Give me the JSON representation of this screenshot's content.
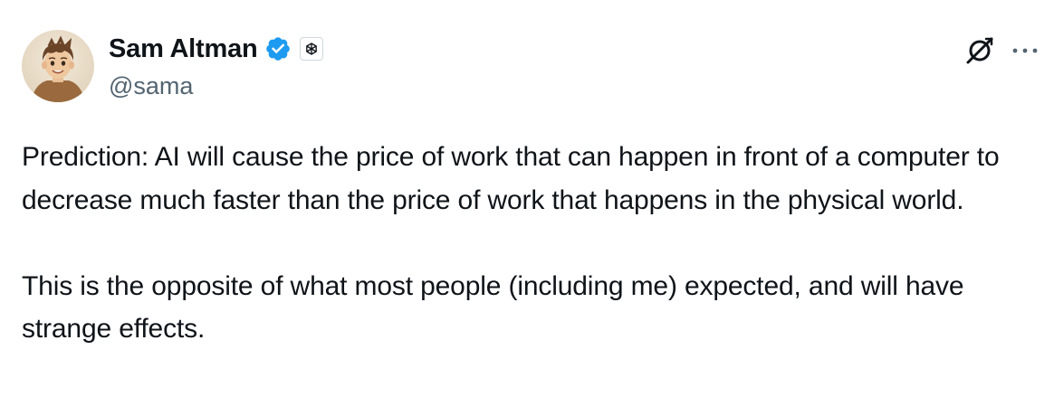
{
  "author": {
    "display_name": "Sam Altman",
    "handle": "@sama",
    "verified": true,
    "verified_color": "#1d9bf0",
    "affiliate_badge_icon": "openai-logo-icon"
  },
  "actions": {
    "grok_icon": "grok-icon",
    "more_icon": "more-horizontal-icon"
  },
  "tweet": {
    "paragraphs": [
      "Prediction: AI will cause the price of work that can happen in front of a computer to decrease much faster than the price of work that happens in the physical world.",
      "This is the opposite of what most people (including me) expected, and will have strange effects."
    ]
  },
  "colors": {
    "text_primary": "#0f1419",
    "text_secondary": "#536471",
    "background": "#ffffff"
  }
}
